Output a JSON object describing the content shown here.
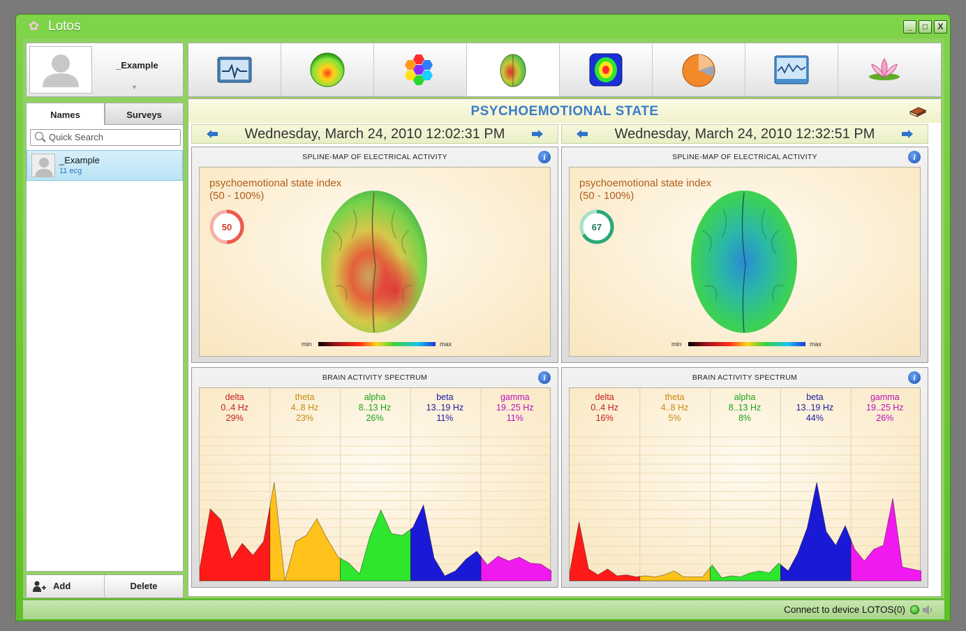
{
  "window": {
    "title": "Lotos",
    "controls": [
      "_",
      "□",
      "X"
    ]
  },
  "sidebar": {
    "profile_name": "_Example",
    "tabs": [
      {
        "label": "Names",
        "active": true
      },
      {
        "label": "Surveys",
        "active": false
      }
    ],
    "search_placeholder": "Quick Search",
    "patients": [
      {
        "name": "_Example",
        "count": "11 ecg"
      }
    ],
    "add_label": "Add",
    "delete_label": "Delete"
  },
  "toolbar": {
    "items": [
      {
        "icon": "ecg-monitor-icon",
        "active": false
      },
      {
        "icon": "energy-sphere-icon",
        "active": false
      },
      {
        "icon": "chakra-hexagons-icon",
        "active": false
      },
      {
        "icon": "brain-map-icon",
        "active": true
      },
      {
        "icon": "thermal-body-icon",
        "active": false
      },
      {
        "icon": "pie-chart-icon",
        "active": false
      },
      {
        "icon": "waveform-chart-icon",
        "active": false
      },
      {
        "icon": "lotus-flower-icon",
        "active": false
      }
    ]
  },
  "view": {
    "title": "PSYCHOEMOTIONAL STATE",
    "left": {
      "date": "Wednesday, March 24, 2010 12:02:31 PM",
      "map_title": "SPLINE-MAP OF ELECTRICAL ACTIVITY",
      "index_label": "psychoemotional state index",
      "index_range": "(50 - 100%)",
      "index_value": "50",
      "scale_min": "min",
      "scale_max": "max",
      "spectrum_title": "BRAIN ACTIVITY SPECTRUM"
    },
    "right": {
      "date": "Wednesday, March 24, 2010 12:32:51 PM",
      "map_title": "SPLINE-MAP OF ELECTRICAL ACTIVITY",
      "index_label": "psychoemotional state index",
      "index_range": "(50 - 100%)",
      "index_value": "67",
      "scale_min": "min",
      "scale_max": "max",
      "spectrum_title": "BRAIN ACTIVITY SPECTRUM"
    }
  },
  "status": {
    "text": "Connect to device LOTOS(0)"
  },
  "colors": {
    "accent_green": "#7fd44a",
    "title_blue": "#3a7bc8",
    "index_orange": "#b25b1a"
  },
  "chart_data": [
    {
      "type": "area",
      "title": "BRAIN ACTIVITY SPECTRUM",
      "categories": [
        "delta",
        "theta",
        "alpha",
        "beta",
        "gamma"
      ],
      "bands": [
        {
          "name": "delta",
          "range": "0..4 Hz",
          "percent": "29%",
          "color": "#ff1a1a",
          "label_color": "#c21d1d"
        },
        {
          "name": "theta",
          "range": "4..8 Hz",
          "percent": "23%",
          "color": "#ffc21a",
          "label_color": "#c78a0e"
        },
        {
          "name": "alpha",
          "range": "8..13 Hz",
          "percent": "26%",
          "color": "#2ee62e",
          "label_color": "#1aa31a"
        },
        {
          "name": "beta",
          "range": "13..19 Hz",
          "percent": "11%",
          "color": "#1a1ad6",
          "label_color": "#1a1a9c"
        },
        {
          "name": "gamma",
          "range": "19..25 Hz",
          "percent": "11%",
          "color": "#f01af0",
          "label_color": "#b514b5"
        }
      ],
      "values": [
        0.12,
        0.73,
        0.62,
        0.22,
        0.38,
        0.26,
        0.4,
        1.0,
        0.0,
        0.4,
        0.46,
        0.63,
        0.42,
        0.24,
        0.18,
        0.07,
        0.46,
        0.72,
        0.48,
        0.46,
        0.54,
        0.77,
        0.23,
        0.05,
        0.1,
        0.22,
        0.3,
        0.16,
        0.25,
        0.2,
        0.24,
        0.18,
        0.17,
        0.1
      ]
    },
    {
      "type": "area",
      "title": "BRAIN ACTIVITY SPECTRUM",
      "categories": [
        "delta",
        "theta",
        "alpha",
        "beta",
        "gamma"
      ],
      "bands": [
        {
          "name": "delta",
          "range": "0..4 Hz",
          "percent": "16%",
          "color": "#ff1a1a",
          "label_color": "#c21d1d"
        },
        {
          "name": "theta",
          "range": "4..8 Hz",
          "percent": "5%",
          "color": "#ffc21a",
          "label_color": "#c78a0e"
        },
        {
          "name": "alpha",
          "range": "8..13 Hz",
          "percent": "8%",
          "color": "#2ee62e",
          "label_color": "#1aa31a"
        },
        {
          "name": "beta",
          "range": "13..19 Hz",
          "percent": "44%",
          "color": "#1a1ad6",
          "label_color": "#1a1a9c"
        },
        {
          "name": "gamma",
          "range": "19..25 Hz",
          "percent": "26%",
          "color": "#f01af0",
          "label_color": "#b514b5"
        }
      ],
      "values": [
        0.08,
        0.6,
        0.12,
        0.06,
        0.12,
        0.05,
        0.06,
        0.04,
        0.05,
        0.04,
        0.06,
        0.1,
        0.04,
        0.04,
        0.04,
        0.16,
        0.03,
        0.05,
        0.04,
        0.08,
        0.1,
        0.08,
        0.18,
        0.1,
        0.28,
        0.54,
        1.0,
        0.5,
        0.36,
        0.56,
        0.32,
        0.2,
        0.32,
        0.36,
        0.84,
        0.14,
        0.12,
        0.1
      ]
    }
  ]
}
